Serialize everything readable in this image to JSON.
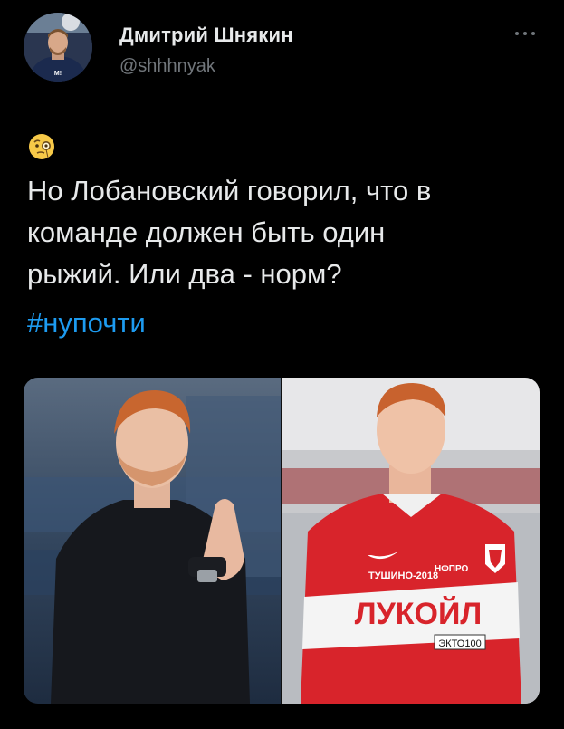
{
  "author": {
    "display_name": "Дмитрий Шнякин",
    "handle": "@shhhnyak",
    "avatar_icon": "avatar-icon"
  },
  "tweet": {
    "emoji_icon": "face-with-monocle-icon",
    "lines": [
      "Но Лобановский говорил, что в",
      "команде должен быть один",
      "рыжий. Или два - норм?"
    ],
    "hashtag": "#нупочти"
  },
  "media": {
    "left_image_icon": "photo-coach-applauding",
    "right_image_icon": "photo-player-spartak-kit",
    "jersey_sponsor": "ЛУКОЙЛ",
    "jersey_sleeve_text": "ТУШИНО-2018",
    "jersey_chest_text": "НФПРО",
    "jersey_badge": "ЭКТО100"
  },
  "colors": {
    "background": "#000000",
    "text": "#e7e9ea",
    "secondary_text": "#71767b",
    "link": "#1d9bf0"
  }
}
